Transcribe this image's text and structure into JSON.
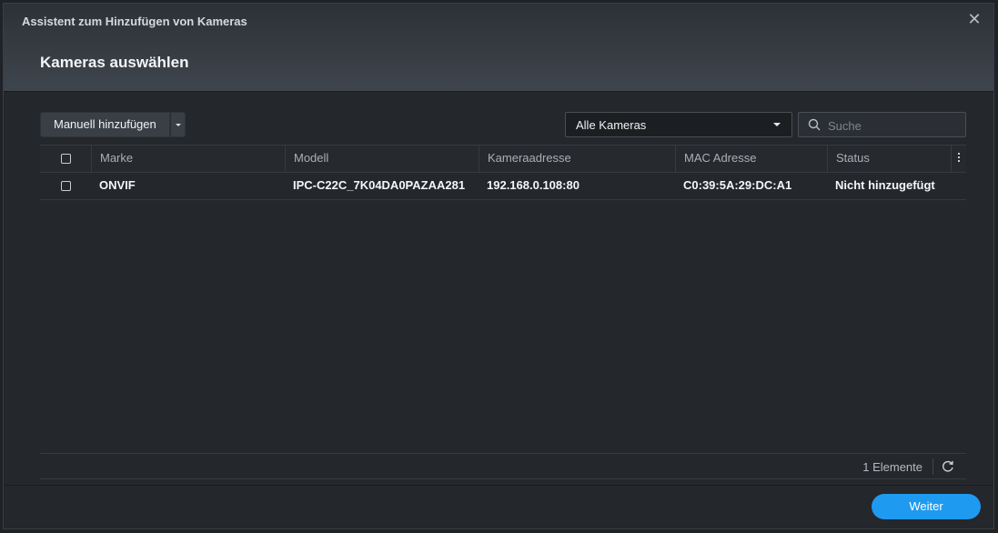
{
  "window": {
    "title": "Assistent zum Hinzufügen von Kameras",
    "close_icon": "close-icon"
  },
  "step": {
    "title": "Kameras auswählen"
  },
  "toolbar": {
    "add_manual_label": "Manuell hinzufügen",
    "filter_value": "Alle Kameras",
    "search_placeholder": "Suche"
  },
  "table": {
    "columns": [
      "Marke",
      "Modell",
      "Kameraadresse",
      "MAC Adresse",
      "Status"
    ],
    "rows": [
      {
        "checked": false,
        "brand": "ONVIF",
        "model": "IPC-C22C_7K04DA0PAZAA281",
        "address": "192.168.0.108:80",
        "mac": "C0:39:5A:29:DC:A1",
        "status": "Nicht hinzugefügt"
      }
    ]
  },
  "footer": {
    "count_label": "1 Elemente"
  },
  "actions": {
    "next_label": "Weiter"
  },
  "colors": {
    "accent": "#1e9af0",
    "background": "#24272b"
  }
}
